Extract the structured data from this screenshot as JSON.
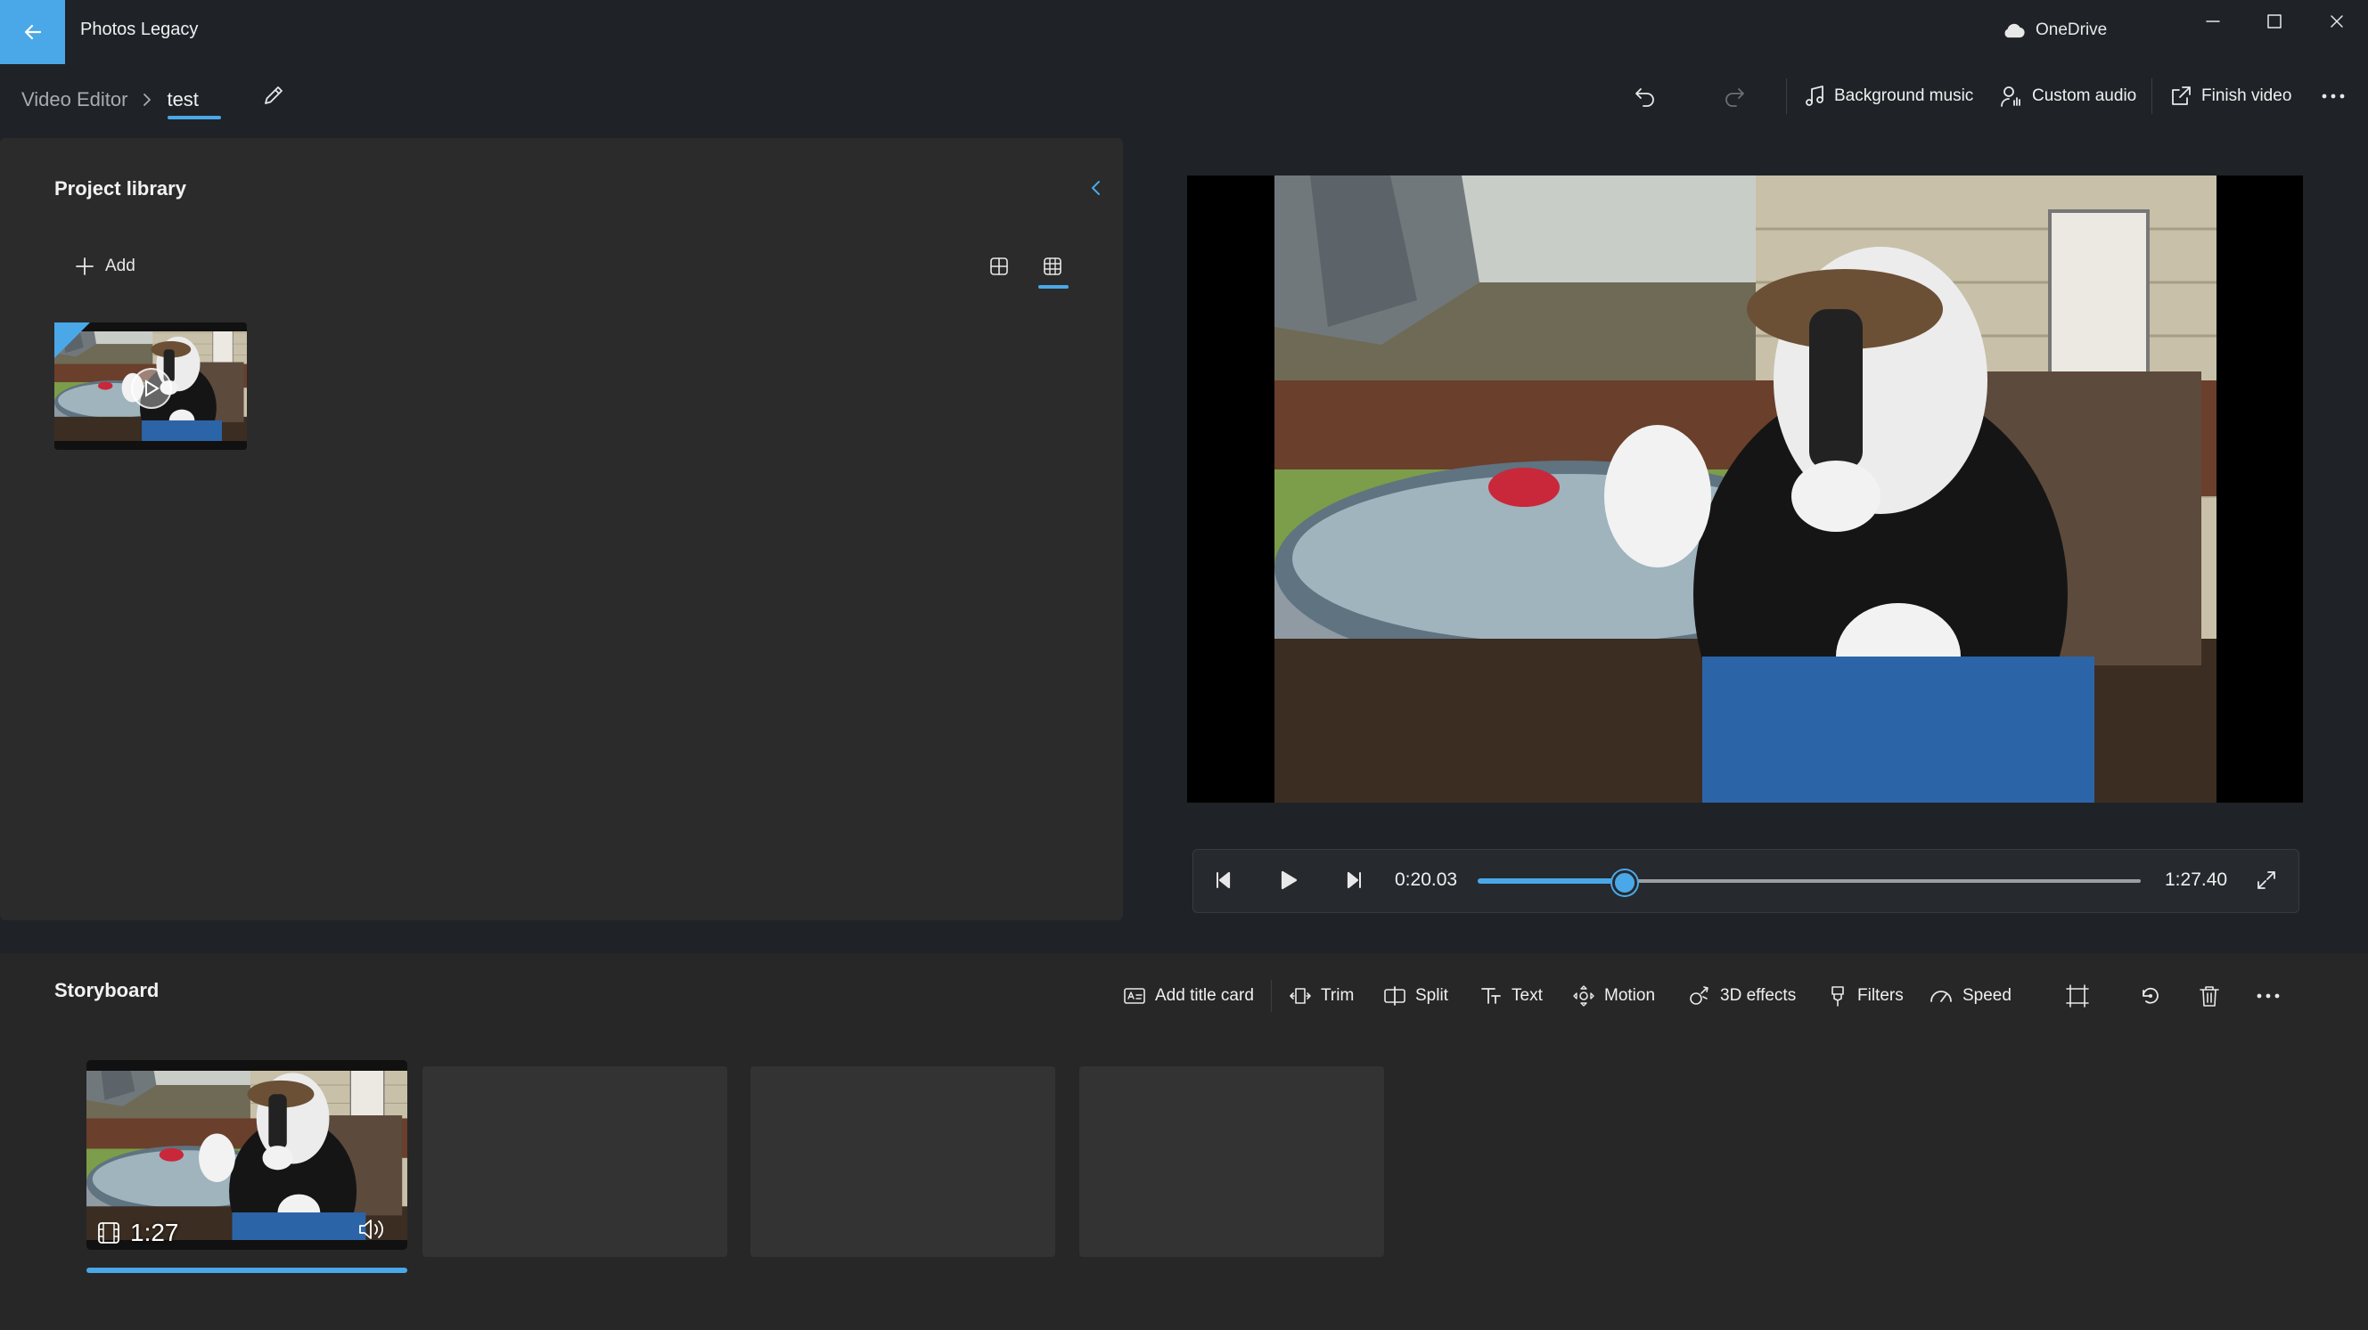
{
  "window": {
    "app_title": "Photos Legacy",
    "cloud_label": "OneDrive",
    "icons": {
      "back": "back-arrow-icon",
      "cloud": "cloud-icon",
      "minimize": "minimize-icon",
      "maximize": "maximize-icon",
      "close": "close-icon"
    },
    "colors": {
      "accent": "#4aa8e8",
      "background": "#1f2328",
      "panel": "#2b2b2b"
    }
  },
  "toolbar": {
    "breadcrumb_root": "Video Editor",
    "breadcrumb_current": "test",
    "background_music_label": "Background music",
    "custom_audio_label": "Custom audio",
    "finish_video_label": "Finish video"
  },
  "library": {
    "title": "Project library",
    "add_label": "Add"
  },
  "player": {
    "current_time": "0:20.03",
    "total_time": "1:27.40",
    "progress_fraction": 0.218
  },
  "storyboard": {
    "title": "Storyboard",
    "tools": {
      "add_title_card": "Add title card",
      "trim": "Trim",
      "split": "Split",
      "text": "Text",
      "motion": "Motion",
      "effects_3d": "3D effects",
      "filters": "Filters",
      "speed": "Speed"
    },
    "clips": [
      {
        "duration": "1:27"
      }
    ]
  }
}
